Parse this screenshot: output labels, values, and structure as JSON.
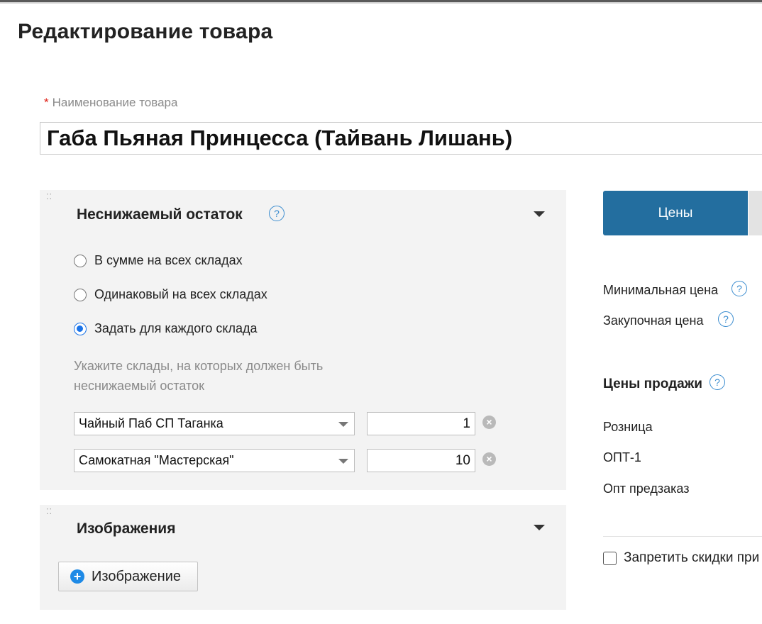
{
  "page": {
    "title": "Редактирование товара"
  },
  "product_name": {
    "label": "Наименование товара",
    "required_mark": "*",
    "value": "Габа Пьяная Принцесса (Тайвань Лишань)"
  },
  "stock_panel": {
    "title": "Неснижаемый остаток",
    "help": "?",
    "options": [
      {
        "label": "В сумме на всех складах",
        "checked": false
      },
      {
        "label": "Одинаковый на всех складах",
        "checked": false
      },
      {
        "label": "Задать для каждого склада",
        "checked": true
      }
    ],
    "hint": "Укажите склады, на которых должен быть неснижаемый остаток",
    "rows": [
      {
        "warehouse": "Чайный Паб СП Таганка",
        "quantity": "1"
      },
      {
        "warehouse": "Самокатная \"Мастерская\"",
        "quantity": "10"
      }
    ]
  },
  "images_panel": {
    "title": "Изображения",
    "add_button": "Изображение"
  },
  "prices": {
    "tab_label": "Цены",
    "min_price": "Минимальная цена",
    "purchase_price": "Закупочная цена",
    "sale_title": "Цены продажи",
    "sale_prices": [
      "Розница",
      "ОПТ-1",
      "Опт предзаказ"
    ],
    "help": "?",
    "discount_label": "Запретить скидки при"
  },
  "colors": {
    "accent": "#236e9f",
    "radio": "#1a73e8",
    "required": "#e0241b",
    "help": "#3a8ccf"
  }
}
